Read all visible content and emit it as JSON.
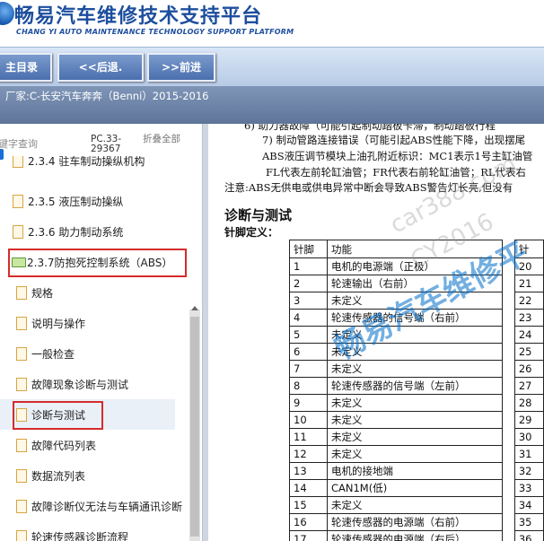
{
  "header": {
    "title": "畅易汽车维修技术支持平台",
    "subtitle": "CHANG YI AUTO MAINTENANCE TECHNOLOGY SUPPORT PLATFORM"
  },
  "nav": {
    "main_label": "主目录",
    "back_label": "<<后退.",
    "forward_label": ">>前进"
  },
  "manufacturer": "厂家:C-长安汽车奔奔（Benni）2015-2016",
  "sidebar": {
    "search_label": "键字查询",
    "doc_code": "PC.33-29367",
    "collapse_label": "折叠全部",
    "items": [
      {
        "label": "2.3.4 驻车制动操纵机构"
      },
      {
        "label": "2.3.5 液压制动操纵"
      },
      {
        "label": "2.3.6 助力制动系统"
      },
      {
        "label": "2.3.7防抱死控制系统（ABS）"
      },
      {
        "label": "规格"
      },
      {
        "label": "说明与操作"
      },
      {
        "label": "一般检查"
      },
      {
        "label": "故障现象诊断与测试"
      },
      {
        "label": "诊断与测试"
      },
      {
        "label": "故障代码列表"
      },
      {
        "label": "数据流列表"
      },
      {
        "label": "故障诊断仪无法与车辆通讯诊断"
      },
      {
        "label": "轮速传感器诊断流程"
      }
    ]
  },
  "content": {
    "line1": "6) 助力器故障（可能引起制动踏板卡滞，制动踏板行程",
    "line2": "7) 制动管路连接错误（可能引起ABS性能下降，出现摆尾",
    "line3": "ABS液压调节模块上油孔附近标识：MC1表示1号主缸油管",
    "line4": "FL代表左前轮缸油管；FR代表右前轮缸油管；RL代表右",
    "note": "注意:ABS无供电或供电异常中断会导致ABS警告灯长亮,但没有",
    "section_title": "诊断与测试",
    "pin_def_label": "针脚定义：",
    "table_headers": [
      "针脚",
      "功能",
      "针"
    ],
    "pins": [
      {
        "no": "1",
        "fn": "电机的电源端（正极）",
        "no2": "20"
      },
      {
        "no": "2",
        "fn": "轮速输出（右前）",
        "no2": "21"
      },
      {
        "no": "3",
        "fn": "未定义",
        "no2": "22"
      },
      {
        "no": "4",
        "fn": "轮速传感器的信号端（右前）",
        "no2": "23"
      },
      {
        "no": "5",
        "fn": "未定义",
        "no2": "24"
      },
      {
        "no": "6",
        "fn": "未定义",
        "no2": "25"
      },
      {
        "no": "7",
        "fn": "未定义",
        "no2": "26"
      },
      {
        "no": "8",
        "fn": "轮速传感器的信号端（左前）",
        "no2": "27"
      },
      {
        "no": "9",
        "fn": "未定义",
        "no2": "28"
      },
      {
        "no": "10",
        "fn": "未定义",
        "no2": "29"
      },
      {
        "no": "11",
        "fn": "未定义",
        "no2": "30"
      },
      {
        "no": "12",
        "fn": "未定义",
        "no2": "31"
      },
      {
        "no": "13",
        "fn": "电机的接地端",
        "no2": "32"
      },
      {
        "no": "14",
        "fn": "CAN1M(低)",
        "no2": "33"
      },
      {
        "no": "15",
        "fn": "未定义",
        "no2": "34"
      },
      {
        "no": "16",
        "fn": "轮速传感器的电源端（右前）",
        "no2": "35"
      },
      {
        "no": "17",
        "fn": "轮速传感器的电源端（右后）",
        "no2": "36"
      }
    ],
    "watermarks": [
      "car388.com",
      "CY2016",
      "畅易汽车维修平"
    ]
  },
  "colors": {
    "brand": "#1d4e9e",
    "nav_button": "#5b7fbd",
    "highlight_box": "#d62b2b"
  }
}
